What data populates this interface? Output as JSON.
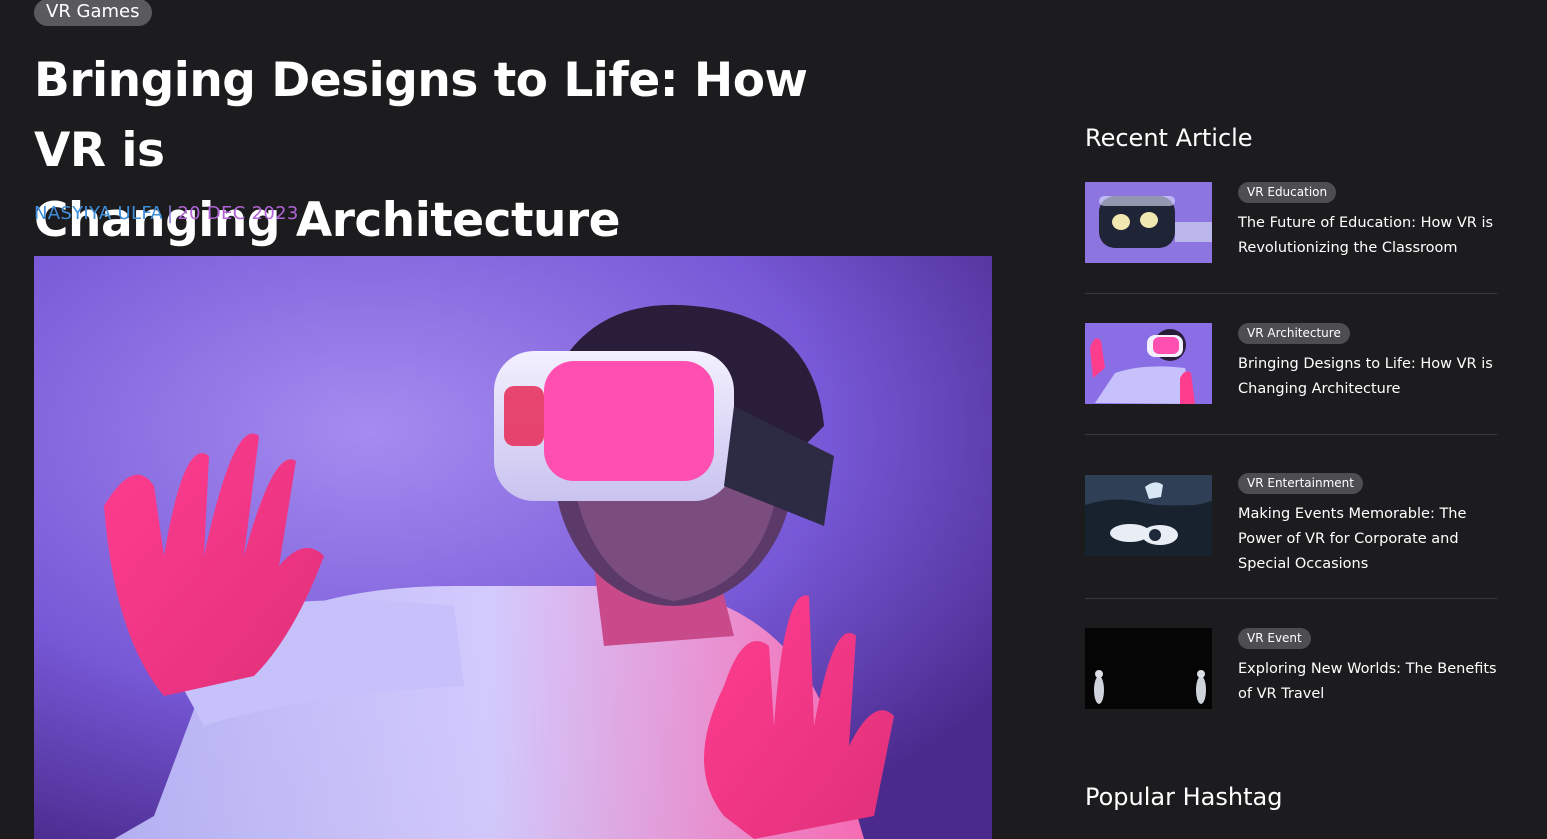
{
  "article": {
    "category": "VR Games",
    "title_line1": "Bringing Designs to Life: How VR is",
    "title_line2": "Changing Architecture",
    "author": "NASYIYA ULFA",
    "separator": "|",
    "date": "20 DEC 2023"
  },
  "sidebar": {
    "recent_heading": "Recent Article",
    "popular_heading": "Popular Hashtag",
    "recent_articles": [
      {
        "tag": "VR Education",
        "title": "The Future of Education: How VR is Revolutionizing the Classroom"
      },
      {
        "tag": "VR Architecture",
        "title": "Bringing Designs to Life: How VR is Changing Architecture"
      },
      {
        "tag": "VR Entertainment",
        "title": "Making Events Memorable: The Power of VR for Corporate and Special Occasions"
      },
      {
        "tag": "VR Event",
        "title": "Exploring New Worlds: The Benefits of VR Travel"
      }
    ]
  },
  "colors": {
    "background": "#1c1c1e",
    "author": "#3f8ed9",
    "date": "#b264d6",
    "pill": "#5a5a5e",
    "tag": "#4e4e52"
  }
}
